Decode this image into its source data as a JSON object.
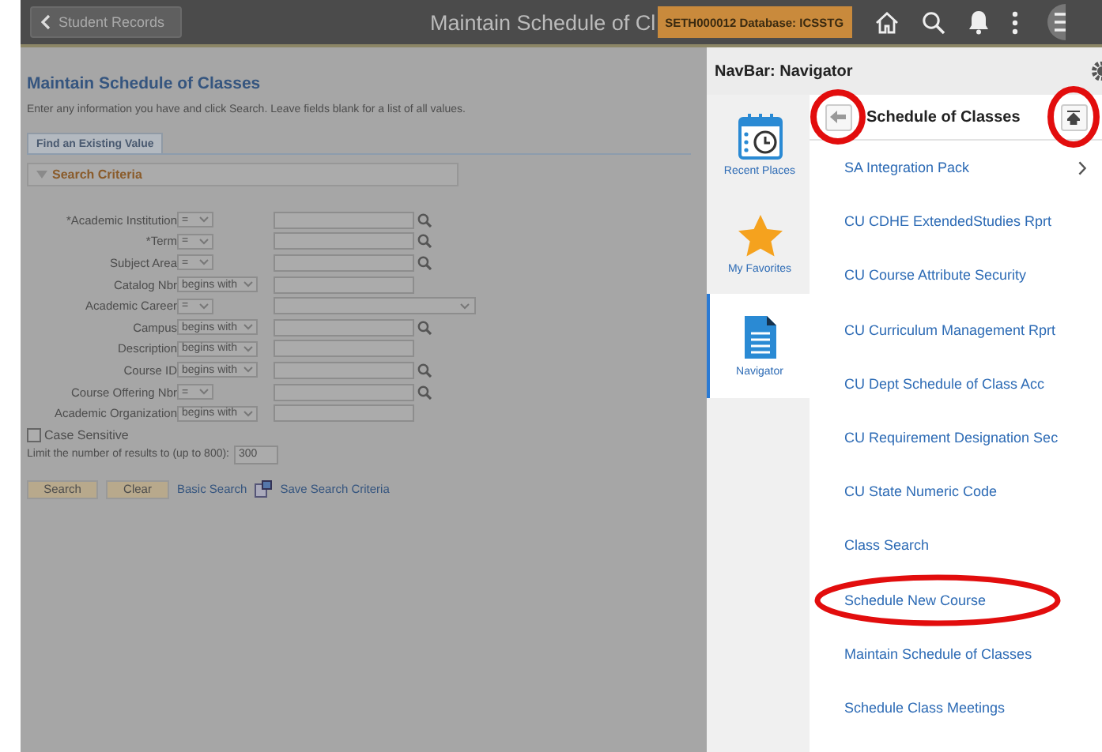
{
  "topbar": {
    "back_label": "Student Records",
    "title": "Maintain Schedule of Cl",
    "env_badge": "SETH000012 Database: ICSSTG"
  },
  "page": {
    "title": "Maintain Schedule of Classes",
    "instructions": "Enter any information you have and click Search. Leave fields blank for a list of all values.",
    "tab": "Find an Existing Value",
    "section": "Search Criteria",
    "fields": [
      {
        "label": "*Academic Institution",
        "operator": "=",
        "kind": "text",
        "lookup": true
      },
      {
        "label": "*Term",
        "operator": "=",
        "kind": "text",
        "lookup": true
      },
      {
        "label": "Subject Area",
        "operator": "=",
        "kind": "text",
        "lookup": true
      },
      {
        "label": "Catalog Nbr",
        "operator": "begins with",
        "kind": "text",
        "lookup": false
      },
      {
        "label": "Academic Career",
        "operator": "=",
        "kind": "select",
        "lookup": false
      },
      {
        "label": "Campus",
        "operator": "begins with",
        "kind": "text",
        "lookup": true
      },
      {
        "label": "Description",
        "operator": "begins with",
        "kind": "text",
        "lookup": false
      },
      {
        "label": "Course ID",
        "operator": "begins with",
        "kind": "text",
        "lookup": true
      },
      {
        "label": "Course Offering Nbr",
        "operator": "=",
        "kind": "text",
        "lookup": true
      },
      {
        "label": "Academic Organization",
        "operator": "begins with",
        "kind": "text",
        "lookup": false
      }
    ],
    "case_sensitive": {
      "label": "Case Sensitive",
      "checked": false
    },
    "limit": {
      "label": "Limit the number of results to (up to 800):",
      "value": "300"
    },
    "buttons": [
      "Search",
      "Clear"
    ],
    "links": [
      "Basic Search",
      "Save Search Criteria"
    ]
  },
  "navbar": {
    "title": "NavBar: Navigator",
    "back_circled": true,
    "top_circled": true,
    "heading": "Schedule of Classes",
    "tiles": [
      {
        "label": "Recent Places",
        "kind": "recent",
        "selected": false
      },
      {
        "label": "My Favorites",
        "kind": "favorites",
        "selected": false
      },
      {
        "label": "Navigator",
        "kind": "navigator",
        "selected": true
      }
    ],
    "items": [
      {
        "label": "SA Integration Pack",
        "folder": true,
        "circled": false
      },
      {
        "label": "CU CDHE ExtendedStudies Rprt",
        "folder": false,
        "circled": false
      },
      {
        "label": "CU Course Attribute Security",
        "folder": false,
        "circled": false
      },
      {
        "label": "CU Curriculum Management Rprt",
        "folder": false,
        "circled": false
      },
      {
        "label": "CU Dept Schedule of Class Acc",
        "folder": false,
        "circled": false
      },
      {
        "label": "CU Requirement Designation Sec",
        "folder": false,
        "circled": false
      },
      {
        "label": "CU State Numeric Code",
        "folder": false,
        "circled": false
      },
      {
        "label": "Class Search",
        "folder": false,
        "circled": false
      },
      {
        "label": "Schedule New Course",
        "folder": false,
        "circled": true
      },
      {
        "label": "Maintain Schedule of Classes",
        "folder": false,
        "circled": false
      },
      {
        "label": "Schedule Class Meetings",
        "folder": false,
        "circled": false
      }
    ]
  }
}
